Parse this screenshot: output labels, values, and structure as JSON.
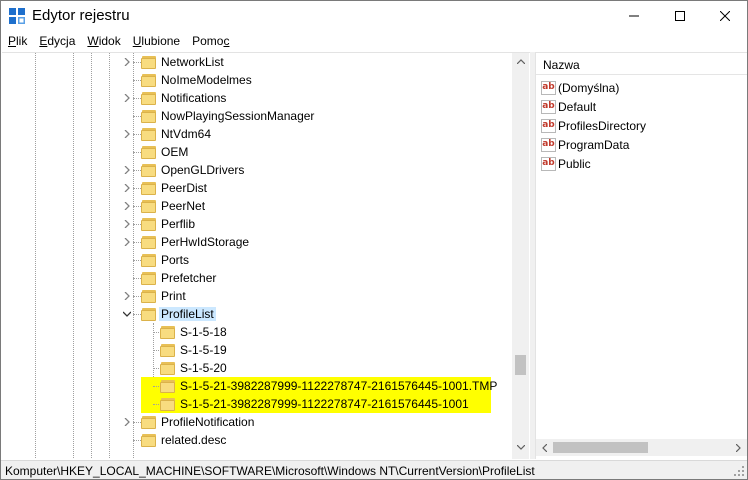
{
  "window": {
    "title": "Edytor rejestru",
    "minimize_glyph": "─",
    "maximize_glyph": "☐",
    "close_glyph": "✕"
  },
  "menu": [
    {
      "label": "Plik",
      "key": "P"
    },
    {
      "label": "Edycja",
      "key": "E"
    },
    {
      "label": "Widok",
      "key": "W"
    },
    {
      "label": "Ulubione",
      "key": "U"
    },
    {
      "label": "Pomoc",
      "key": "c"
    }
  ],
  "tree": {
    "nodes": [
      {
        "label": "NetworkList",
        "expander": "collapsed",
        "depth": 0
      },
      {
        "label": "NoImeModelmes",
        "expander": "none",
        "depth": 0
      },
      {
        "label": "Notifications",
        "expander": "collapsed",
        "depth": 0
      },
      {
        "label": "NowPlayingSessionManager",
        "expander": "none",
        "depth": 0
      },
      {
        "label": "NtVdm64",
        "expander": "collapsed",
        "depth": 0
      },
      {
        "label": "OEM",
        "expander": "none",
        "depth": 0
      },
      {
        "label": "OpenGLDrivers",
        "expander": "collapsed",
        "depth": 0
      },
      {
        "label": "PeerDist",
        "expander": "collapsed",
        "depth": 0
      },
      {
        "label": "PeerNet",
        "expander": "collapsed",
        "depth": 0
      },
      {
        "label": "Perflib",
        "expander": "collapsed",
        "depth": 0
      },
      {
        "label": "PerHwIdStorage",
        "expander": "collapsed",
        "depth": 0
      },
      {
        "label": "Ports",
        "expander": "none",
        "depth": 0
      },
      {
        "label": "Prefetcher",
        "expander": "none",
        "depth": 0
      },
      {
        "label": "Print",
        "expander": "collapsed",
        "depth": 0
      },
      {
        "label": "ProfileList",
        "expander": "expanded",
        "depth": 0,
        "selected": true
      },
      {
        "label": "S-1-5-18",
        "expander": "none",
        "depth": 1
      },
      {
        "label": "S-1-5-19",
        "expander": "none",
        "depth": 1
      },
      {
        "label": "S-1-5-20",
        "expander": "none",
        "depth": 1
      },
      {
        "label": "S-1-5-21-3982287999-1122278747-2161576445-1001.TMP",
        "expander": "none",
        "depth": 1,
        "highlighted": true
      },
      {
        "label": "S-1-5-21-3982287999-1122278747-2161576445-1001",
        "expander": "none",
        "depth": 1,
        "highlighted": true
      },
      {
        "label": "ProfileNotification",
        "expander": "collapsed",
        "depth": 0
      },
      {
        "label": "related.desc",
        "expander": "none",
        "depth": 0
      }
    ]
  },
  "values_pane": {
    "column_header": "Nazwa",
    "icon_text": "ab",
    "items": [
      {
        "name": "(Domyślna)"
      },
      {
        "name": "Default"
      },
      {
        "name": "ProfilesDirectory"
      },
      {
        "name": "ProgramData"
      },
      {
        "name": "Public"
      }
    ]
  },
  "statusbar": {
    "path": "Komputer\\HKEY_LOCAL_MACHINE\\SOFTWARE\\Microsoft\\Windows NT\\CurrentVersion\\ProfileList"
  },
  "colors": {
    "highlight": "#ffff00",
    "selection": "#cce8ff",
    "folder": "#f8dc80"
  }
}
